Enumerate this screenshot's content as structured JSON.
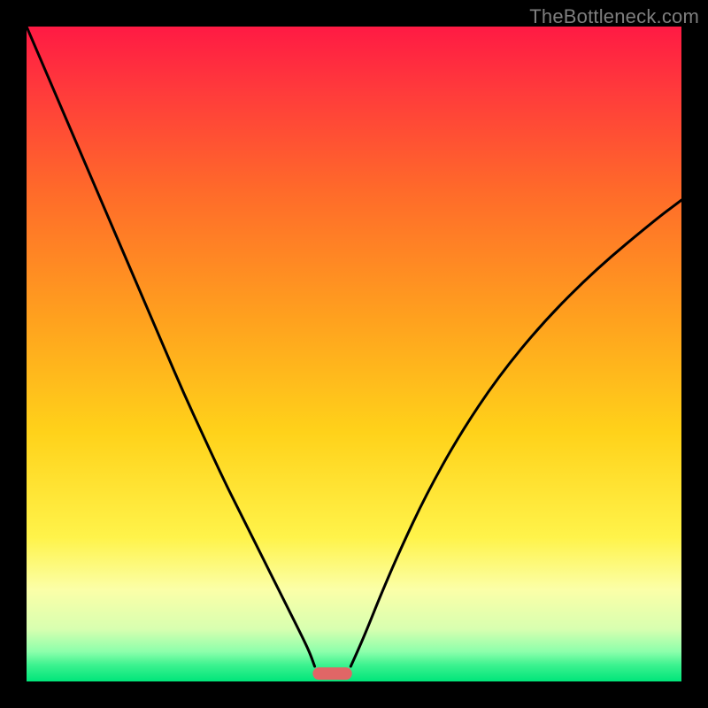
{
  "attribution": "TheBottleneck.com",
  "chart_data": {
    "type": "line",
    "title": "",
    "xlabel": "",
    "ylabel": "",
    "xlim": [
      0,
      100
    ],
    "ylim": [
      0,
      100
    ],
    "background_gradient": {
      "stops": [
        {
          "offset": 0.0,
          "color": "#ff1a44"
        },
        {
          "offset": 0.1,
          "color": "#ff3b3b"
        },
        {
          "offset": 0.25,
          "color": "#ff6a2a"
        },
        {
          "offset": 0.45,
          "color": "#ffa21e"
        },
        {
          "offset": 0.62,
          "color": "#ffd21a"
        },
        {
          "offset": 0.78,
          "color": "#fff34a"
        },
        {
          "offset": 0.86,
          "color": "#fbffa8"
        },
        {
          "offset": 0.92,
          "color": "#d8ffb0"
        },
        {
          "offset": 0.955,
          "color": "#8bffab"
        },
        {
          "offset": 0.975,
          "color": "#3cf28f"
        },
        {
          "offset": 1.0,
          "color": "#00e57a"
        }
      ]
    },
    "series": [
      {
        "name": "left-curve",
        "x": [
          0.0,
          3.0,
          6.0,
          9.0,
          12.0,
          15.0,
          18.0,
          21.0,
          24.0,
          27.0,
          30.0,
          33.0,
          36.0,
          38.5,
          40.5,
          42.0,
          43.2,
          44.0
        ],
        "y": [
          100.0,
          93.0,
          86.0,
          79.0,
          72.0,
          65.0,
          58.0,
          51.0,
          44.0,
          37.5,
          31.0,
          25.0,
          19.0,
          14.0,
          10.0,
          7.0,
          4.5,
          2.3
        ]
      },
      {
        "name": "right-curve",
        "x": [
          49.5,
          50.5,
          52.0,
          54.0,
          57.0,
          61.0,
          66.0,
          72.0,
          79.0,
          87.0,
          96.0,
          100.0
        ],
        "y": [
          2.3,
          4.5,
          8.0,
          13.0,
          20.0,
          28.5,
          37.5,
          46.5,
          55.0,
          63.0,
          70.5,
          73.5
        ]
      }
    ],
    "marker": {
      "name": "bottom-marker",
      "x_center": 46.7,
      "width": 6.0,
      "y": 1.2,
      "height": 1.9,
      "color": "#e06666"
    },
    "baseline": {
      "y": 0.0,
      "color": "#00e57a"
    }
  }
}
